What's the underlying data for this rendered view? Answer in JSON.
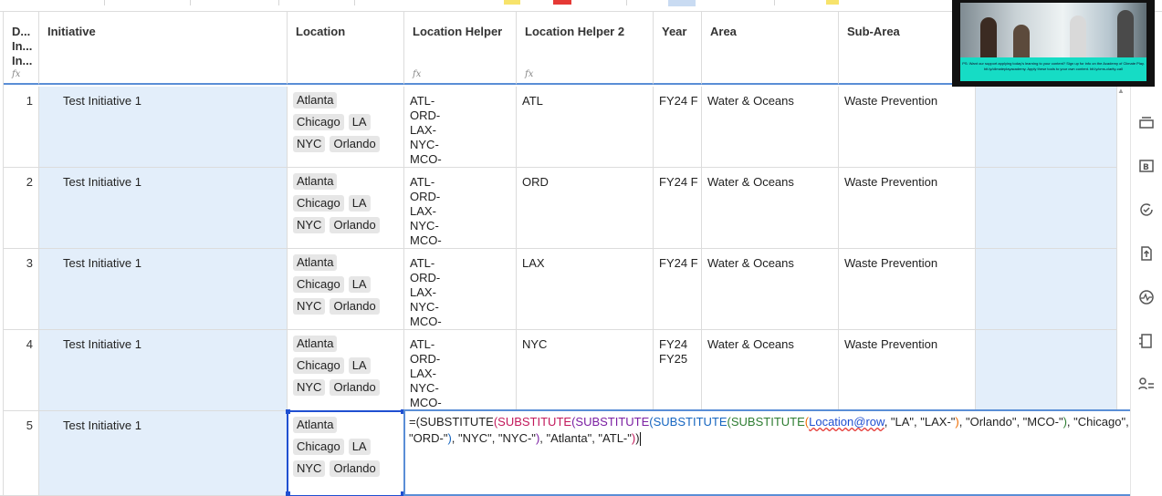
{
  "columns": [
    {
      "key": "d",
      "label": "D... In... In...",
      "fx": true
    },
    {
      "key": "initiative",
      "label": "Initiative",
      "fx": false
    },
    {
      "key": "location",
      "label": "Location",
      "fx": false
    },
    {
      "key": "helper",
      "label": "Location Helper",
      "fx": true
    },
    {
      "key": "helper2",
      "label": "Location Helper 2",
      "fx": true
    },
    {
      "key": "year",
      "label": "Year",
      "fx": false
    },
    {
      "key": "area",
      "label": "Area",
      "fx": false
    },
    {
      "key": "subarea",
      "label": "Sub-Area",
      "fx": false
    }
  ],
  "fx_glyph": "fx",
  "rows": [
    {
      "num": "1",
      "initiative": "Test Initiative 1",
      "locations": [
        "Atlanta",
        "Chicago",
        "LA",
        "NYC",
        "Orlando"
      ],
      "helper": [
        "ATL-",
        "ORD-",
        "LAX-",
        "NYC-",
        "MCO-"
      ],
      "helper2": "ATL",
      "year": [
        "FY24 F"
      ],
      "area": "Water & Oceans",
      "subarea": "Waste Prevention"
    },
    {
      "num": "2",
      "initiative": "Test Initiative 1",
      "locations": [
        "Atlanta",
        "Chicago",
        "LA",
        "NYC",
        "Orlando"
      ],
      "helper": [
        "ATL-",
        "ORD-",
        "LAX-",
        "NYC-",
        "MCO-"
      ],
      "helper2": "ORD",
      "year": [
        "FY24 F"
      ],
      "area": "Water & Oceans",
      "subarea": "Waste Prevention"
    },
    {
      "num": "3",
      "initiative": "Test Initiative 1",
      "locations": [
        "Atlanta",
        "Chicago",
        "LA",
        "NYC",
        "Orlando"
      ],
      "helper": [
        "ATL-",
        "ORD-",
        "LAX-",
        "NYC-",
        "MCO-"
      ],
      "helper2": "LAX",
      "year": [
        "FY24 F"
      ],
      "area": "Water & Oceans",
      "subarea": "Waste Prevention"
    },
    {
      "num": "4",
      "initiative": "Test Initiative 1",
      "locations": [
        "Atlanta",
        "Chicago",
        "LA",
        "NYC",
        "Orlando"
      ],
      "helper": [
        "ATL-",
        "ORD-",
        "LAX-",
        "NYC-",
        "MCO-"
      ],
      "helper2": "NYC",
      "year": [
        "FY24",
        "FY25"
      ],
      "area": "Water & Oceans",
      "subarea": "Waste Prevention"
    },
    {
      "num": "5",
      "initiative": "Test Initiative 1",
      "locations": [
        "Atlanta",
        "Chicago",
        "LA",
        "NYC",
        "Orlando"
      ]
    }
  ],
  "formula": {
    "eq": "=",
    "seg1": "(SUBSTITUTE",
    "seg2": "(SUBSTITUTE",
    "seg3": "(SUBSTITUTE",
    "seg4": "(SUBSTITUTE",
    "seg5": "(SUBSTITUTE",
    "seg6": "(",
    "ref": "Location@row",
    "arg1": ", \"LA\", \"LAX-\"",
    "c1": ")",
    "arg2": ", \"Orlando\", \"MCO-\"",
    "c2": ")",
    "arg3": ", \"Chicago\", \"ORD-\"",
    "c3": ")",
    "arg4": ", \"NYC\", \"NYC-\"",
    "c4": ")",
    "arg5": ", \"Atlanta\", \"ATL-\"",
    "c5": ")",
    "c6": ")"
  },
  "sidebar_icons": [
    "layers-icon",
    "briefcase-icon",
    "refresh-check-icon",
    "upload-file-icon",
    "activity-icon",
    "report-icon",
    "user-list-icon"
  ],
  "video_caption": "PS: Want our support applying today's learning to your content? Sign up for info on the Academy of Climate Play. bit.ly/climateplayacademy. Apply these tools to your own content. bit.ly/cms-clarity-call",
  "colors": {
    "accent": "#1f4fd1",
    "column_highlight": "#e3eefa",
    "video_banner": "#16dcc5"
  }
}
